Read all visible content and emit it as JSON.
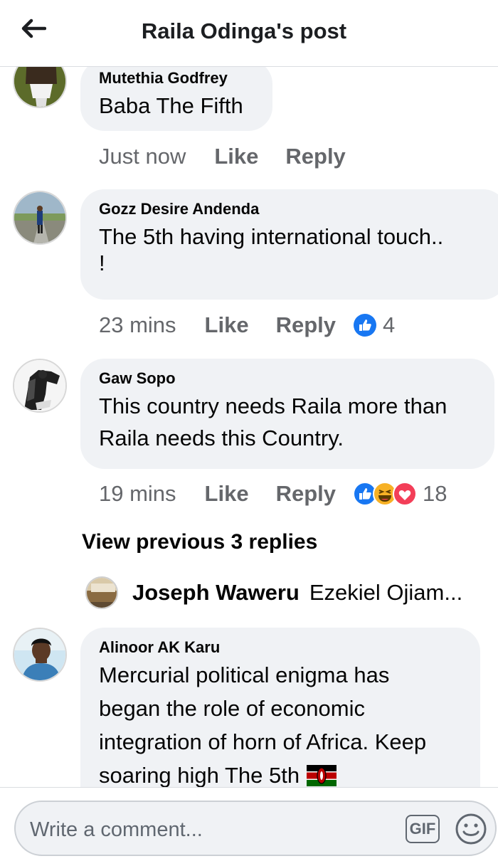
{
  "header": {
    "title": "Raila Odinga's post"
  },
  "comments": [
    {
      "author": "Mutethia Godfrey",
      "text": "Baba The Fifth",
      "time": "Just now",
      "like_label": "Like",
      "reply_label": "Reply"
    },
    {
      "author": "Gozz Desire Andenda",
      "text_lines": [
        "The  5th having international touch..",
        "!"
      ],
      "time": "23 mins",
      "like_label": "Like",
      "reply_label": "Reply",
      "reaction_count": "4",
      "reactions": [
        "like-reaction-icon"
      ]
    },
    {
      "author": "Gaw Sopo",
      "text_lines": [
        "This country needs Raila more than",
        "Raila needs this Country."
      ],
      "time": "19 mins",
      "like_label": "Like",
      "reply_label": "Reply",
      "reaction_count": "18",
      "reactions": [
        "like-reaction-icon",
        "haha-reaction-icon",
        "love-reaction-icon"
      ]
    }
  ],
  "view_previous": "View previous 3 replies",
  "latest_reply": {
    "author": "Joseph Waweru",
    "preview": "Ezekiel Ojiam..."
  },
  "last_comment": {
    "author": "Alinoor AK Karu",
    "text_lines": [
      "Mercurial political enigma has",
      "began the role of economic",
      "integration of horn of Africa. Keep",
      "soaring high The 5th"
    ],
    "flag_icon": "kenya-flag-icon"
  },
  "composer": {
    "placeholder": "Write a comment...",
    "gif_label": "GIF"
  },
  "colors": {
    "like_blue": "#1877f2",
    "love_red": "#f33e58",
    "haha_yellow": "#f7b125",
    "bubble_bg": "#f0f2f5",
    "meta_gray": "#65676b"
  }
}
